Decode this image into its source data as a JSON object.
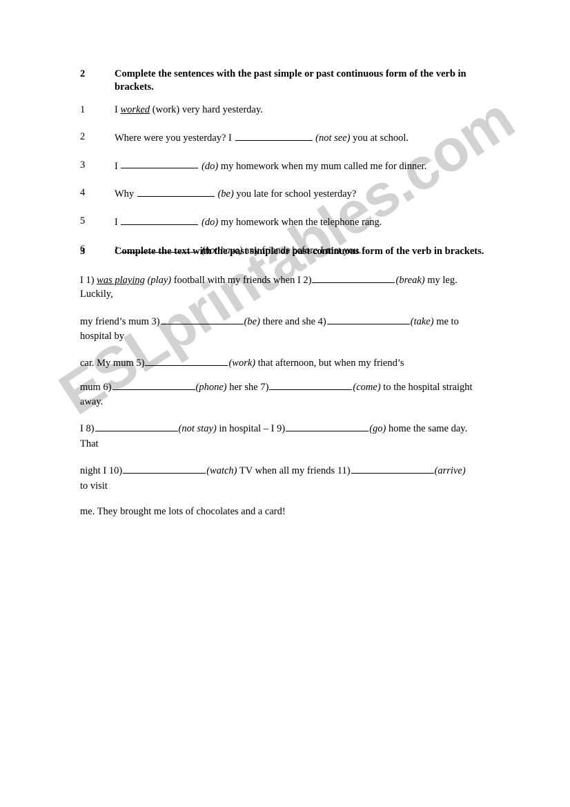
{
  "watermark": {
    "text": "ESLprintables.com",
    "color": "#d2d2d2"
  },
  "exercise2": {
    "number": "2",
    "instruction": "Complete the sentences with the past simple or past continuous form of the verb in brackets.",
    "items": [
      {
        "number": "1",
        "pre": "I",
        "answer": "worked",
        "blank": false,
        "verb": "(work)",
        "verb_italic": false,
        "post": "very hard yesterday."
      },
      {
        "number": "2",
        "pre": "Where were you yesterday? I",
        "answer": "",
        "blank": true,
        "verb": "(not see)",
        "verb_italic": true,
        "post": "you at school."
      },
      {
        "number": "3",
        "pre": "I",
        "answer": "",
        "blank": true,
        "verb": "(do)",
        "verb_italic": true,
        "post": "my homework when my mum called me for dinner."
      },
      {
        "number": "4",
        "pre": "Why",
        "answer": "",
        "blank": true,
        "verb": "(be)",
        "verb_italic": true,
        "post": "you late for school yesterday?"
      },
      {
        "number": "5",
        "pre": "I",
        "answer": "",
        "blank": true,
        "verb": "(do)",
        "verb_italic": true,
        "post": "my homework when the telephone rang."
      },
      {
        "number": "6",
        "pre": "I",
        "answer": "",
        "blank": true,
        "verb": "(not have)",
        "verb_italic": true,
        "post": "any friends before I met you."
      }
    ]
  },
  "exercise3": {
    "number": "3",
    "instruction": "Complete the text with the past simple or past continuous form of the verb in brackets.",
    "lines": [
      {
        "id": "l1",
        "segs": [
          {
            "t": "I 1) ",
            "s": "plain"
          },
          {
            "t": "was playing",
            "s": "answer"
          },
          {
            "t": " ",
            "s": "plain"
          },
          {
            "t": "(play)",
            "s": "verb"
          },
          {
            "t": " football with my friends when I 2)",
            "s": "plain"
          },
          {
            "t": "",
            "s": "blank"
          },
          {
            "t": "(break)",
            "s": "verb"
          },
          {
            "t": " my leg.",
            "s": "plain"
          }
        ]
      },
      {
        "id": "l1b",
        "segs": [
          {
            "t": "Luckily,",
            "s": "plain"
          }
        ]
      },
      {
        "id": "l2",
        "segs": [
          {
            "t": "my friend’s mum 3)",
            "s": "plain"
          },
          {
            "t": "",
            "s": "blank"
          },
          {
            "t": "(be)",
            "s": "verb"
          },
          {
            "t": " there and she 4)",
            "s": "plain"
          },
          {
            "t": "",
            "s": "blank"
          },
          {
            "t": "(take)",
            "s": "verb"
          },
          {
            "t": " me to",
            "s": "plain"
          }
        ]
      },
      {
        "id": "l2b",
        "segs": [
          {
            "t": "hospital by",
            "s": "plain"
          }
        ]
      },
      {
        "id": "l3",
        "segs": [
          {
            "t": "car. My mum 5)",
            "s": "plain"
          },
          {
            "t": "",
            "s": "blank"
          },
          {
            "t": "(work)",
            "s": "verb"
          },
          {
            "t": " that afternoon, but when my friend’s",
            "s": "plain"
          }
        ]
      },
      {
        "id": "l4",
        "segs": [
          {
            "t": "mum 6)",
            "s": "plain"
          },
          {
            "t": "",
            "s": "blank"
          },
          {
            "t": "(phone)",
            "s": "verb"
          },
          {
            "t": " her she 7)",
            "s": "plain"
          },
          {
            "t": "",
            "s": "blank"
          },
          {
            "t": "(come)",
            "s": "verb"
          },
          {
            "t": " to the hospital straight",
            "s": "plain"
          }
        ]
      },
      {
        "id": "l4b",
        "segs": [
          {
            "t": "away.",
            "s": "plain"
          }
        ]
      },
      {
        "id": "l5",
        "segs": [
          {
            "t": "I 8)",
            "s": "plain"
          },
          {
            "t": "",
            "s": "blank"
          },
          {
            "t": "(not stay)",
            "s": "verb"
          },
          {
            "t": " in hospital – I 9)",
            "s": "plain"
          },
          {
            "t": "",
            "s": "blank"
          },
          {
            "t": "(go)",
            "s": "verb"
          },
          {
            "t": " home the same day.",
            "s": "plain"
          }
        ]
      },
      {
        "id": "l5b",
        "segs": [
          {
            "t": "That",
            "s": "plain"
          }
        ]
      },
      {
        "id": "l6",
        "segs": [
          {
            "t": "night I 10)",
            "s": "plain"
          },
          {
            "t": "",
            "s": "blank"
          },
          {
            "t": "(watch)",
            "s": "verb"
          },
          {
            "t": " TV when all my friends 11)",
            "s": "plain"
          },
          {
            "t": "",
            "s": "blank"
          },
          {
            "t": "(arrive)",
            "s": "verb"
          }
        ]
      },
      {
        "id": "l6b",
        "segs": [
          {
            "t": "to visit",
            "s": "plain"
          }
        ]
      },
      {
        "id": "l7",
        "segs": [
          {
            "t": "me. They brought me lots of chocolates and a card!",
            "s": "plain"
          }
        ]
      }
    ],
    "line_tops": {
      "l1": 395,
      "l1b": 417,
      "l2": 455,
      "l2b": 478,
      "l3": 515,
      "l4": 550,
      "l4b": 573,
      "l5": 610,
      "l5b": 634,
      "l6": 671,
      "l6b": 695,
      "l7": 732
    }
  }
}
